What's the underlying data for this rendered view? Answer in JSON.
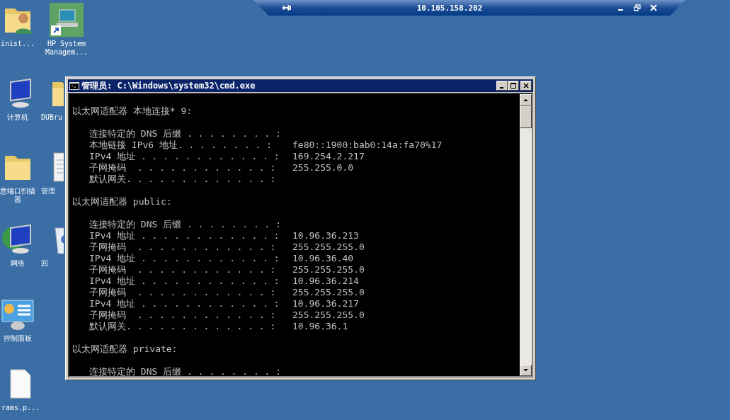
{
  "remote_bar": {
    "title": "10.105.158.202"
  },
  "desktop_icons": [
    {
      "kind": "user-folder",
      "label": "inist..."
    },
    {
      "kind": "monitor-shortcut",
      "label": "HP System Managem..."
    },
    {
      "kind": "computer",
      "label": "计算机"
    },
    {
      "kind": "folder",
      "label": "DUBru"
    },
    {
      "kind": "folder",
      "label": "意端口扫描器"
    },
    {
      "kind": "notepad",
      "label": "管理"
    },
    {
      "kind": "network",
      "label": "网络"
    },
    {
      "kind": "recycle-bin",
      "label": "回"
    },
    {
      "kind": "control-panel",
      "label": "控制面板"
    },
    {
      "kind": "file",
      "label": "rams.p..."
    }
  ],
  "console_window": {
    "title": "管理员: C:\\Windows\\system32\\cmd.exe",
    "lines": [
      {
        "kind": "blank"
      },
      {
        "kind": "heading",
        "text": "以太网适配器 本地连接* 9:"
      },
      {
        "kind": "blank"
      },
      {
        "kind": "entry",
        "label": "连接特定的 DNS 后缀 . . . . . . . . :"
      },
      {
        "kind": "entry",
        "label": "本地链接 IPv6 地址. . . . . . . . :",
        "value": "fe80::1900:bab0:14a:fa70%17"
      },
      {
        "kind": "entry",
        "label": "IPv4 地址 . . . . . . . . . . . . :",
        "value": "169.254.2.217"
      },
      {
        "kind": "entry",
        "label": "子网掩码  . . . . . . . . . . . . :",
        "value": "255.255.0.0"
      },
      {
        "kind": "entry",
        "label": "默认网关. . . . . . . . . . . . . :"
      },
      {
        "kind": "blank"
      },
      {
        "kind": "heading",
        "text": "以太网适配器 public:"
      },
      {
        "kind": "blank"
      },
      {
        "kind": "entry",
        "label": "连接特定的 DNS 后缀 . . . . . . . . :"
      },
      {
        "kind": "entry",
        "label": "IPv4 地址 . . . . . . . . . . . . :",
        "value": "10.96.36.213"
      },
      {
        "kind": "entry",
        "label": "子网掩码  . . . . . . . . . . . . :",
        "value": "255.255.255.0"
      },
      {
        "kind": "entry",
        "label": "IPv4 地址 . . . . . . . . . . . . :",
        "value": "10.96.36.40"
      },
      {
        "kind": "entry",
        "label": "子网掩码  . . . . . . . . . . . . :",
        "value": "255.255.255.0"
      },
      {
        "kind": "entry",
        "label": "IPv4 地址 . . . . . . . . . . . . :",
        "value": "10.96.36.214"
      },
      {
        "kind": "entry",
        "label": "子网掩码  . . . . . . . . . . . . :",
        "value": "255.255.255.0"
      },
      {
        "kind": "entry",
        "label": "IPv4 地址 . . . . . . . . . . . . :",
        "value": "10.96.36.217"
      },
      {
        "kind": "entry",
        "label": "子网掩码  . . . . . . . . . . . . :",
        "value": "255.255.255.0"
      },
      {
        "kind": "entry",
        "label": "默认网关. . . . . . . . . . . . . :",
        "value": "10.96.36.1"
      },
      {
        "kind": "blank"
      },
      {
        "kind": "heading",
        "text": "以太网适配器 private:"
      },
      {
        "kind": "blank"
      },
      {
        "kind": "entry",
        "label": "连接特定的 DNS 后缀 . . . . . . . . :"
      }
    ]
  }
}
